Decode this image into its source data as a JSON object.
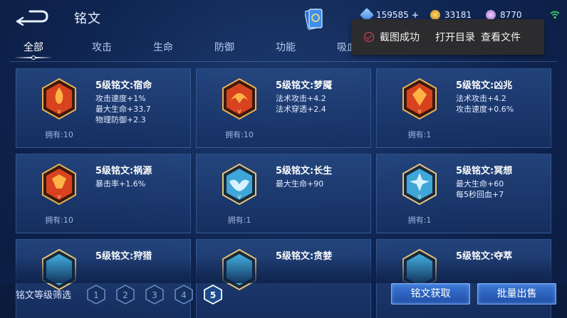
{
  "header": {
    "title": "铭文",
    "currencies": [
      {
        "icon": "diamond-icon",
        "value": "159585",
        "plus": "+"
      },
      {
        "icon": "gold-coin-icon",
        "value": "33181"
      },
      {
        "icon": "crystal-icon",
        "value": "8770"
      }
    ]
  },
  "tabs": [
    {
      "label": "全部",
      "active": true
    },
    {
      "label": "攻击"
    },
    {
      "label": "生命"
    },
    {
      "label": "防御"
    },
    {
      "label": "功能"
    },
    {
      "label": "吸血"
    }
  ],
  "toast": {
    "message": "截图成功",
    "actions": [
      "打开目录",
      "查看文件"
    ]
  },
  "runes": [
    {
      "name": "5级铭文:宿命",
      "stats": [
        "攻击速度+1%",
        "最大生命+33.7",
        "物理防御+2.3"
      ],
      "owned": "拥有:10",
      "color": "#d9421e"
    },
    {
      "name": "5级铭文:梦魇",
      "stats": [
        "法术攻击+4.2",
        "法术穿透+2.4"
      ],
      "owned": "拥有:10",
      "color": "#d9421e"
    },
    {
      "name": "5级铭文:凶兆",
      "stats": [
        "法术攻击+4.2",
        "攻击速度+0.6%"
      ],
      "owned": "拥有:1",
      "color": "#d9421e"
    },
    {
      "name": "5级铭文:祸源",
      "stats": [
        "暴击率+1.6%"
      ],
      "owned": "拥有:10",
      "color": "#d9421e"
    },
    {
      "name": "5级铭文:长生",
      "stats": [
        "最大生命+90"
      ],
      "owned": "拥有:1",
      "color": "#3ea6d8"
    },
    {
      "name": "5级铭文:冥想",
      "stats": [
        "最大生命+60",
        "每5秒回血+7"
      ],
      "owned": "拥有:1",
      "color": "#3ea6d8"
    },
    {
      "name": "5级铭文:狩猎",
      "stats": [],
      "owned": "",
      "color": "#3ea6d8"
    },
    {
      "name": "5级铭文:贪婪",
      "stats": [],
      "owned": "",
      "color": "#3ea6d8"
    },
    {
      "name": "5级铭文:夺萃",
      "stats": [],
      "owned": "",
      "color": "#3ea6d8"
    }
  ],
  "bottom": {
    "filter_label": "铭文等级筛选",
    "levels": [
      "1",
      "2",
      "3",
      "4",
      "5"
    ],
    "selected_level": "5",
    "get_button": "铭文获取",
    "sell_button": "批量出售"
  }
}
